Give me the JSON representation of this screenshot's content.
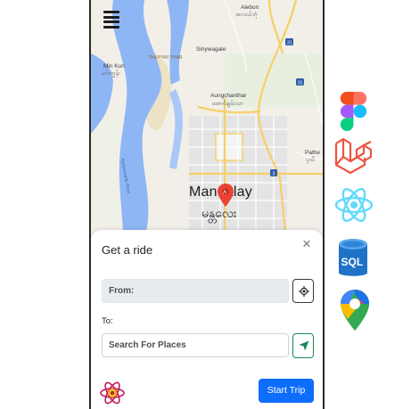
{
  "map": {
    "places": {
      "alebon": "Alebon",
      "alebon_local": "အလယ်ဘုံ",
      "sinywagale": "Sinywagale",
      "tha_pyay_thar": "THA PYAY THAR",
      "min_kun": "Min Kun",
      "min_kun_local": "မင်းကွန်း",
      "aungchanthar": "Aungchanthar",
      "aungchanthar_local": "အောင်ချမ်းသာ",
      "pathein": "Pathe",
      "pathein_local": "ပုသိ",
      "city_english": "Mandalay",
      "city_local": "မန္တလေး"
    },
    "road_shields": [
      "31",
      "31",
      "3"
    ]
  },
  "sheet": {
    "title": "Get a ride",
    "close_label": "×",
    "from_value": "From:",
    "to_label": "To:",
    "to_placeholder": "Search For Places",
    "start_button": "Start Trip"
  },
  "tech_icons": [
    "figma-icon",
    "laravel-icon",
    "react-icon",
    "sql-server-icon",
    "google-maps-icon"
  ],
  "tech_labels": {
    "sql": "SQL"
  },
  "colors": {
    "primary": "#0d6efd",
    "success": "#198754",
    "river": "#8fb6f4",
    "road_yellow": "#f6cf65",
    "react": "#61dafb",
    "laravel": "#f05340"
  }
}
